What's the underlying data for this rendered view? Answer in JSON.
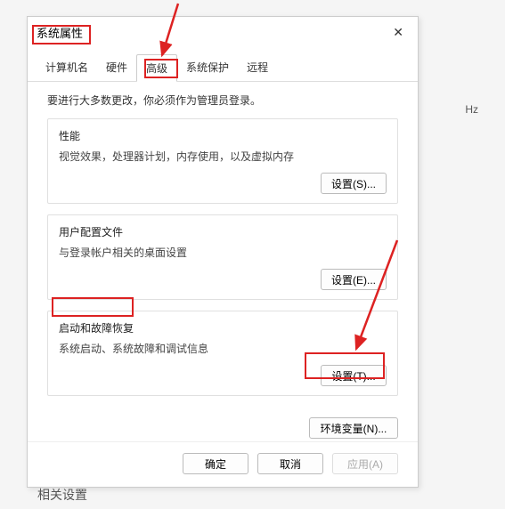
{
  "dialog": {
    "title": "系统属性",
    "close_icon": "✕"
  },
  "tabs": {
    "computer_name": "计算机名",
    "hardware": "硬件",
    "advanced": "高级",
    "system_protection": "系统保护",
    "remote": "远程"
  },
  "notice": "要进行大多数更改，你必须作为管理员登录。",
  "performance": {
    "title": "性能",
    "desc": "视觉效果，处理器计划，内存使用，以及虚拟内存",
    "button": "设置(S)..."
  },
  "user_profiles": {
    "title": "用户配置文件",
    "desc": "与登录帐户相关的桌面设置",
    "button": "设置(E)..."
  },
  "startup": {
    "title": "启动和故障恢复",
    "desc": "系统启动、系统故障和调试信息",
    "button": "设置(T)..."
  },
  "env_button": "环境变量(N)...",
  "footer": {
    "ok": "确定",
    "cancel": "取消",
    "apply": "应用(A)"
  },
  "side_hz": "Hz",
  "related_settings": "相关设置"
}
